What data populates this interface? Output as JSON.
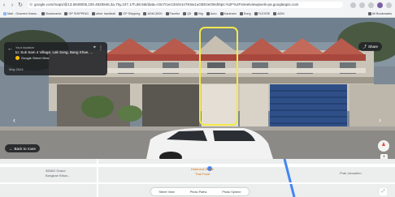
{
  "browser": {
    "url": "google.com/maps/@13.5848005,100.4825945,3a,75y,247.17h,88.56t/data=!3m7!1e1!3m5!1sTK6w1uGBI!2e0!6shttps:%2F%2Fstreetviewpixels-pa.googleapis.com",
    "back_icon": "arrow-left-icon",
    "forward_icon": "arrow-right-icon",
    "reload_icon": "reload-icon",
    "bookmarks": [
      {
        "label": "Mail - Oraveen Kaew..."
      },
      {
        "label": "Bookmarks"
      },
      {
        "label": "GP SHIPPING"
      },
      {
        "label": "other handball"
      },
      {
        "label": "OP Shipping"
      },
      {
        "label": "ADM-3000"
      },
      {
        "label": "Facebo"
      },
      {
        "label": "Q5"
      },
      {
        "label": "Big"
      },
      {
        "label": "Auto"
      },
      {
        "label": "Karsham"
      },
      {
        "label": "Song"
      },
      {
        "label": "FLEXSE"
      },
      {
        "label": "ADM"
      }
    ],
    "all_bookmarks_label": "All Bookmarks"
  },
  "street_view": {
    "info_card": {
      "title": "Your location",
      "address": "to: Suk Sam 4 Village, Lak Song, Bang Khae, ...",
      "source": "Google Street View",
      "date": "May 2024"
    },
    "share_label": "Share",
    "back_to_route_label": "Back to route"
  },
  "map": {
    "labels": [
      {
        "text": "3558/2 Grand"
      },
      {
        "text": "Bangkae Kitwa..."
      },
      {
        "text": "Diamond Grace"
      },
      {
        "text": "Thai Food"
      },
      {
        "text": "Prak Jamadien"
      }
    ],
    "toolbar": {
      "street_view_label": "Street View",
      "photo_paths_label": "Photo Paths",
      "photo_sphere_label": "Photo Sphere"
    }
  }
}
